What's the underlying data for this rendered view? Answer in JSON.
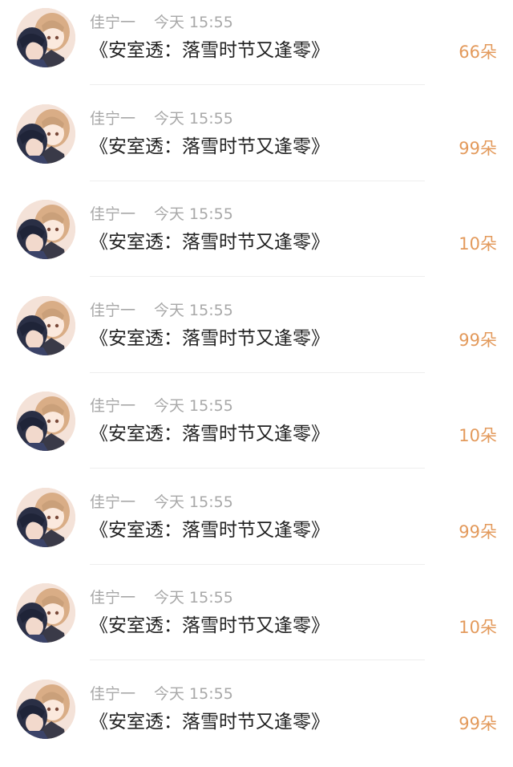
{
  "colors": {
    "username": "#a8a8a8",
    "timestamp": "#a8a8a8",
    "title": "#222222",
    "amount": "#e39a5c",
    "separator": "#eeeeee"
  },
  "avatar_icon": "anime-couple-avatar",
  "items": [
    {
      "user": "佳宁一",
      "time": "今天 15:55",
      "title": "《安室透：落雪时节又逢零》",
      "amount": "66朵"
    },
    {
      "user": "佳宁一",
      "time": "今天 15:55",
      "title": "《安室透：落雪时节又逢零》",
      "amount": "99朵"
    },
    {
      "user": "佳宁一",
      "time": "今天 15:55",
      "title": "《安室透：落雪时节又逢零》",
      "amount": "10朵"
    },
    {
      "user": "佳宁一",
      "time": "今天 15:55",
      "title": "《安室透：落雪时节又逢零》",
      "amount": "99朵"
    },
    {
      "user": "佳宁一",
      "time": "今天 15:55",
      "title": "《安室透：落雪时节又逢零》",
      "amount": "10朵"
    },
    {
      "user": "佳宁一",
      "time": "今天 15:55",
      "title": "《安室透：落雪时节又逢零》",
      "amount": "99朵"
    },
    {
      "user": "佳宁一",
      "time": "今天 15:55",
      "title": "《安室透：落雪时节又逢零》",
      "amount": "10朵"
    },
    {
      "user": "佳宁一",
      "time": "今天 15:55",
      "title": "《安室透：落雪时节又逢零》",
      "amount": "99朵"
    }
  ]
}
